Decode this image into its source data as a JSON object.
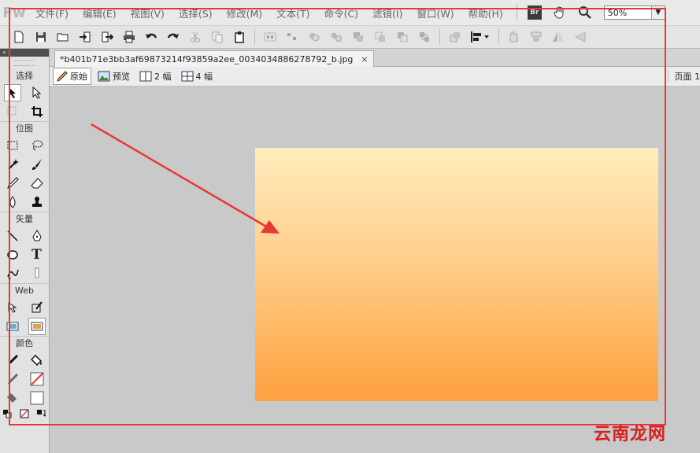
{
  "app": {
    "logo": "Fw"
  },
  "menu": [
    "文件(F)",
    "编辑(E)",
    "视图(V)",
    "选择(S)",
    "修改(M)",
    "文本(T)",
    "命令(C)",
    "滤镜(I)",
    "窗口(W)",
    "帮助(H)"
  ],
  "menu_tools": {
    "bridge_label": "Br",
    "zoom_value": "50%"
  },
  "tools_panel": {
    "header": "»",
    "groups": {
      "select": "选择",
      "bitmap": "位图",
      "vector": "矢量",
      "web": "Web",
      "colors": "颜色"
    },
    "text_tool_glyph": "T"
  },
  "document": {
    "tab_title": "*b401b71e3bb3af69873214f93859a2ee_0034034886278792_b.jpg",
    "close_glyph": "×"
  },
  "viewbar": {
    "original": "原始",
    "preview": "预览",
    "two_up": "2 幅",
    "four_up": "4 幅",
    "page": "页面 1"
  },
  "image": {
    "gradient_top": "#ffedbd",
    "gradient_bottom": "#ffa040"
  },
  "annotation": {
    "color": "#e53935"
  },
  "watermark": "云南龙网"
}
